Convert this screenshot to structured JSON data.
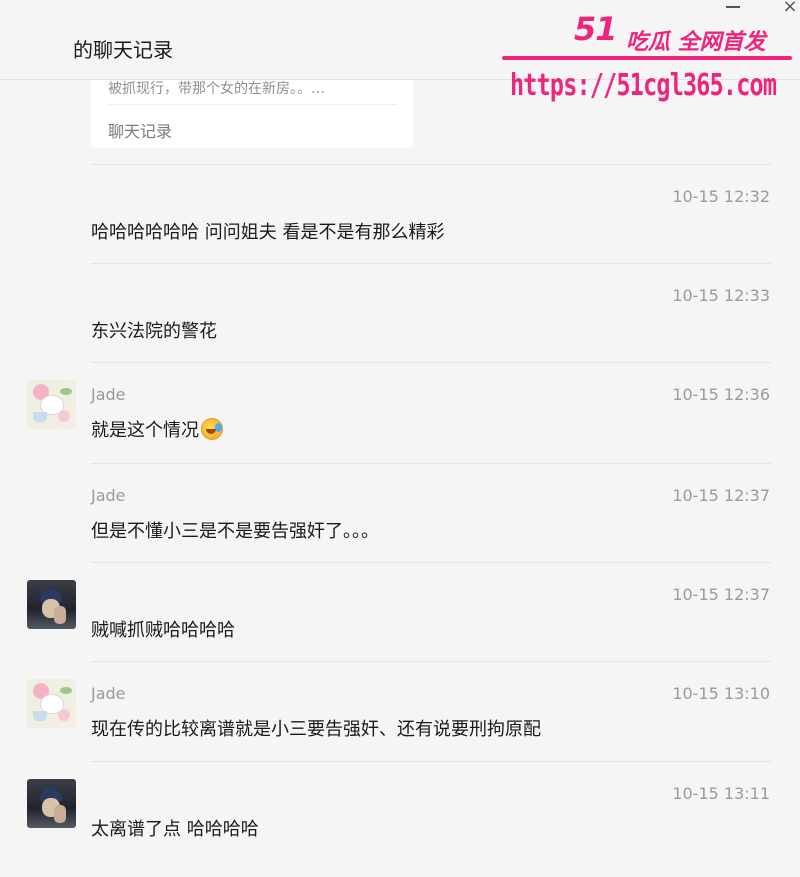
{
  "window": {
    "title": "的聊天记录",
    "close_glyph": "×"
  },
  "watermark": {
    "brand": "51",
    "slogan": "吃瓜 全网首发",
    "url": "https://51cgl365.com"
  },
  "quote_card": {
    "text": "被抓现行，带那个女的在新房。。…",
    "label": "聊天记录"
  },
  "messages": [
    {
      "sender": "",
      "time": "10-15 12:32",
      "text": "哈哈哈哈哈哈 问问姐夫 看是不是有那么精彩",
      "avatar": "none"
    },
    {
      "sender": "",
      "time": "10-15 12:33",
      "text": "东兴法院的警花",
      "avatar": "none"
    },
    {
      "sender": "Jade",
      "time": "10-15 12:36",
      "text": "就是这个情况",
      "avatar": "jade-avatar",
      "emoji": "crying-laughing-emoji"
    },
    {
      "sender": "Jade",
      "time": "10-15 12:37",
      "text": "但是不懂小三是不是要告强奸了。。。",
      "avatar": "none"
    },
    {
      "sender": "",
      "time": "10-15 12:37",
      "text": "贼喊抓贼哈哈哈哈",
      "avatar": "user-avatar"
    },
    {
      "sender": "Jade",
      "time": "10-15 13:10",
      "text": "现在传的比较离谱就是小三要告强奸、还有说要刑拘原配",
      "avatar": "jade-avatar"
    },
    {
      "sender": "",
      "time": "10-15 13:11",
      "text": "太离谱了点 哈哈哈哈",
      "avatar": "user-avatar"
    }
  ],
  "colors": {
    "background": "#f5f5f5",
    "watermark": "#f0247d",
    "meta_text": "#9a9a9a"
  }
}
